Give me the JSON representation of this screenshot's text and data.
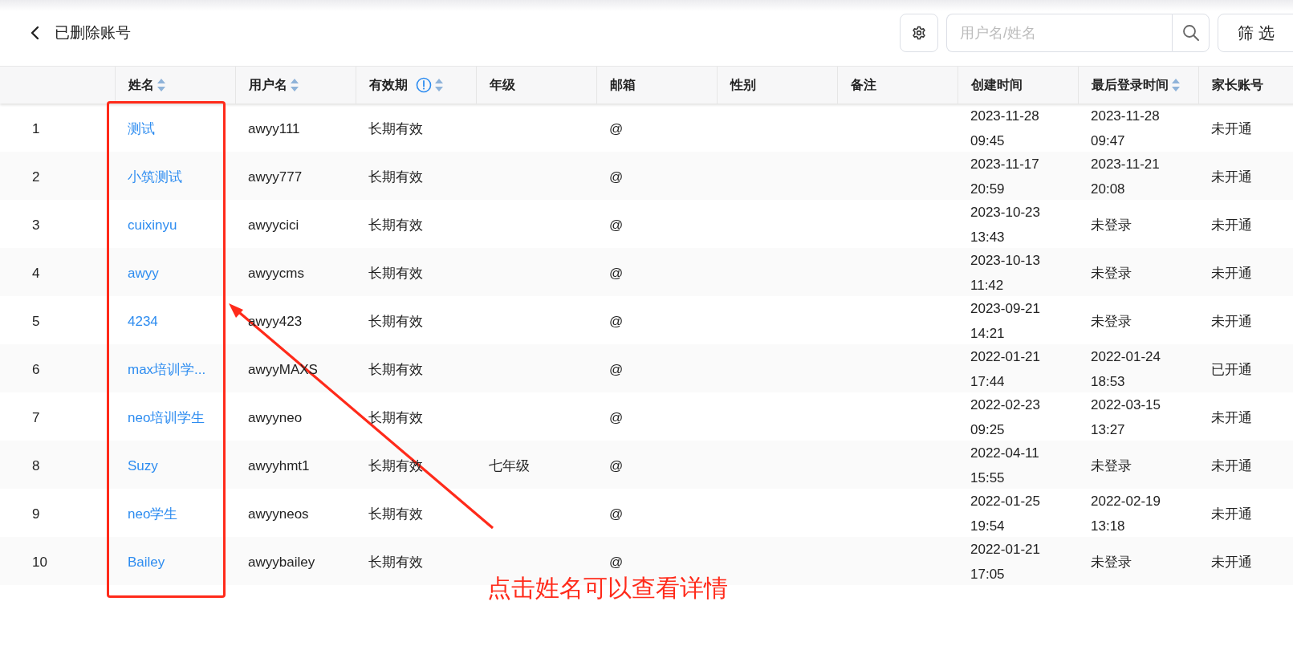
{
  "header": {
    "title": "已删除账号",
    "search": {
      "placeholder": "用户名/姓名"
    },
    "filter_button": "筛 选"
  },
  "table": {
    "columns": [
      {
        "label": "姓名",
        "sortable": true,
        "info": false
      },
      {
        "label": "用户名",
        "sortable": true,
        "info": false
      },
      {
        "label": "有效期",
        "sortable": true,
        "info": true
      },
      {
        "label": "年级",
        "sortable": false,
        "info": false
      },
      {
        "label": "邮箱",
        "sortable": false,
        "info": false
      },
      {
        "label": "性别",
        "sortable": false,
        "info": false
      },
      {
        "label": "备注",
        "sortable": false,
        "info": false
      },
      {
        "label": "创建时间",
        "sortable": false,
        "info": false
      },
      {
        "label": "最后登录时间",
        "sortable": true,
        "info": false
      },
      {
        "label": "家长账号",
        "sortable": false,
        "info": false
      }
    ],
    "rows": [
      {
        "index": "1",
        "name": "测试",
        "username": "awyy111",
        "validity": "长期有效",
        "email": "@",
        "created": "2023-11-28 09:45",
        "last_login": "2023-11-28 09:47",
        "parent_account": "未开通"
      },
      {
        "index": "2",
        "name": "小筑测试",
        "username": "awyy777",
        "validity": "长期有效",
        "email": "@",
        "created": "2023-11-17 20:59",
        "last_login": "2023-11-21 20:08",
        "parent_account": "未开通"
      },
      {
        "index": "3",
        "name": "cuixinyu",
        "username": "awyycici",
        "validity": "长期有效",
        "email": "@",
        "created": "2023-10-23 13:43",
        "last_login": "未登录",
        "parent_account": "未开通"
      },
      {
        "index": "4",
        "name": "awyy",
        "username": "awyycms",
        "validity": "长期有效",
        "email": "@",
        "created": "2023-10-13 11:42",
        "last_login": "未登录",
        "parent_account": "未开通"
      },
      {
        "index": "5",
        "name": "4234",
        "username": "awyy423",
        "validity": "长期有效",
        "email": "@",
        "created": "2023-09-21 14:21",
        "last_login": "未登录",
        "parent_account": "未开通"
      },
      {
        "index": "6",
        "name": "max培训学...",
        "username": "awyyMAXS",
        "validity": "长期有效",
        "email": "@",
        "created": "2022-01-21 17:44",
        "last_login": "2022-01-24 18:53",
        "parent_account": "已开通"
      },
      {
        "index": "7",
        "name": "neo培训学生",
        "username": "awyyneo",
        "validity": "长期有效",
        "email": "@",
        "created": "2022-02-23 09:25",
        "last_login": "2022-03-15 13:27",
        "parent_account": "未开通"
      },
      {
        "index": "8",
        "name": "Suzy",
        "username": "awyyhmt1",
        "validity": "长期有效",
        "grade": "七年级",
        "email": "@",
        "created": "2022-04-11 15:55",
        "last_login": "未登录",
        "parent_account": "未开通"
      },
      {
        "index": "9",
        "name": "neo学生",
        "username": "awyyneos",
        "validity": "长期有效",
        "email": "@",
        "created": "2022-01-25 19:54",
        "last_login": "2022-02-19 13:18",
        "parent_account": "未开通"
      },
      {
        "index": "10",
        "name": "Bailey",
        "username": "awyybailey",
        "validity": "长期有效",
        "email": "@",
        "created": "2022-01-21 17:05",
        "last_login": "未登录",
        "parent_account": "未开通"
      }
    ]
  },
  "annotation": {
    "text": "点击姓名可以查看详情"
  }
}
